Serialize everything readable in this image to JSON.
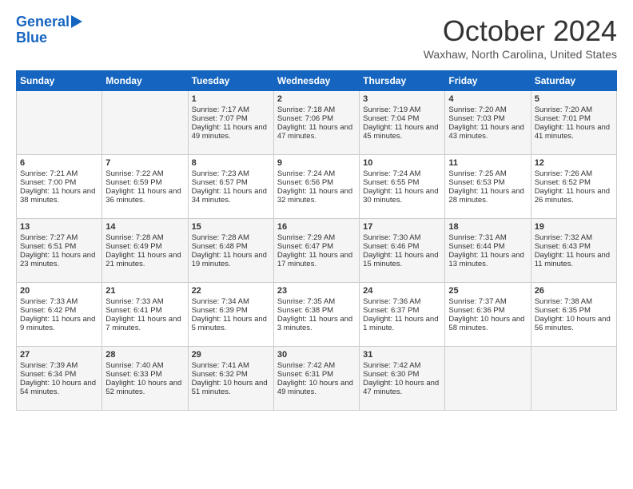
{
  "logo": {
    "line1": "General",
    "line2": "Blue",
    "arrow": true
  },
  "title": "October 2024",
  "location": "Waxhaw, North Carolina, United States",
  "headers": [
    "Sunday",
    "Monday",
    "Tuesday",
    "Wednesday",
    "Thursday",
    "Friday",
    "Saturday"
  ],
  "weeks": [
    [
      {
        "day": "",
        "text": ""
      },
      {
        "day": "",
        "text": ""
      },
      {
        "day": "1",
        "text": "Sunrise: 7:17 AM\nSunset: 7:07 PM\nDaylight: 11 hours and 49 minutes."
      },
      {
        "day": "2",
        "text": "Sunrise: 7:18 AM\nSunset: 7:06 PM\nDaylight: 11 hours and 47 minutes."
      },
      {
        "day": "3",
        "text": "Sunrise: 7:19 AM\nSunset: 7:04 PM\nDaylight: 11 hours and 45 minutes."
      },
      {
        "day": "4",
        "text": "Sunrise: 7:20 AM\nSunset: 7:03 PM\nDaylight: 11 hours and 43 minutes."
      },
      {
        "day": "5",
        "text": "Sunrise: 7:20 AM\nSunset: 7:01 PM\nDaylight: 11 hours and 41 minutes."
      }
    ],
    [
      {
        "day": "6",
        "text": "Sunrise: 7:21 AM\nSunset: 7:00 PM\nDaylight: 11 hours and 38 minutes."
      },
      {
        "day": "7",
        "text": "Sunrise: 7:22 AM\nSunset: 6:59 PM\nDaylight: 11 hours and 36 minutes."
      },
      {
        "day": "8",
        "text": "Sunrise: 7:23 AM\nSunset: 6:57 PM\nDaylight: 11 hours and 34 minutes."
      },
      {
        "day": "9",
        "text": "Sunrise: 7:24 AM\nSunset: 6:56 PM\nDaylight: 11 hours and 32 minutes."
      },
      {
        "day": "10",
        "text": "Sunrise: 7:24 AM\nSunset: 6:55 PM\nDaylight: 11 hours and 30 minutes."
      },
      {
        "day": "11",
        "text": "Sunrise: 7:25 AM\nSunset: 6:53 PM\nDaylight: 11 hours and 28 minutes."
      },
      {
        "day": "12",
        "text": "Sunrise: 7:26 AM\nSunset: 6:52 PM\nDaylight: 11 hours and 26 minutes."
      }
    ],
    [
      {
        "day": "13",
        "text": "Sunrise: 7:27 AM\nSunset: 6:51 PM\nDaylight: 11 hours and 23 minutes."
      },
      {
        "day": "14",
        "text": "Sunrise: 7:28 AM\nSunset: 6:49 PM\nDaylight: 11 hours and 21 minutes."
      },
      {
        "day": "15",
        "text": "Sunrise: 7:28 AM\nSunset: 6:48 PM\nDaylight: 11 hours and 19 minutes."
      },
      {
        "day": "16",
        "text": "Sunrise: 7:29 AM\nSunset: 6:47 PM\nDaylight: 11 hours and 17 minutes."
      },
      {
        "day": "17",
        "text": "Sunrise: 7:30 AM\nSunset: 6:46 PM\nDaylight: 11 hours and 15 minutes."
      },
      {
        "day": "18",
        "text": "Sunrise: 7:31 AM\nSunset: 6:44 PM\nDaylight: 11 hours and 13 minutes."
      },
      {
        "day": "19",
        "text": "Sunrise: 7:32 AM\nSunset: 6:43 PM\nDaylight: 11 hours and 11 minutes."
      }
    ],
    [
      {
        "day": "20",
        "text": "Sunrise: 7:33 AM\nSunset: 6:42 PM\nDaylight: 11 hours and 9 minutes."
      },
      {
        "day": "21",
        "text": "Sunrise: 7:33 AM\nSunset: 6:41 PM\nDaylight: 11 hours and 7 minutes."
      },
      {
        "day": "22",
        "text": "Sunrise: 7:34 AM\nSunset: 6:39 PM\nDaylight: 11 hours and 5 minutes."
      },
      {
        "day": "23",
        "text": "Sunrise: 7:35 AM\nSunset: 6:38 PM\nDaylight: 11 hours and 3 minutes."
      },
      {
        "day": "24",
        "text": "Sunrise: 7:36 AM\nSunset: 6:37 PM\nDaylight: 11 hours and 1 minute."
      },
      {
        "day": "25",
        "text": "Sunrise: 7:37 AM\nSunset: 6:36 PM\nDaylight: 10 hours and 58 minutes."
      },
      {
        "day": "26",
        "text": "Sunrise: 7:38 AM\nSunset: 6:35 PM\nDaylight: 10 hours and 56 minutes."
      }
    ],
    [
      {
        "day": "27",
        "text": "Sunrise: 7:39 AM\nSunset: 6:34 PM\nDaylight: 10 hours and 54 minutes."
      },
      {
        "day": "28",
        "text": "Sunrise: 7:40 AM\nSunset: 6:33 PM\nDaylight: 10 hours and 52 minutes."
      },
      {
        "day": "29",
        "text": "Sunrise: 7:41 AM\nSunset: 6:32 PM\nDaylight: 10 hours and 51 minutes."
      },
      {
        "day": "30",
        "text": "Sunrise: 7:42 AM\nSunset: 6:31 PM\nDaylight: 10 hours and 49 minutes."
      },
      {
        "day": "31",
        "text": "Sunrise: 7:42 AM\nSunset: 6:30 PM\nDaylight: 10 hours and 47 minutes."
      },
      {
        "day": "",
        "text": ""
      },
      {
        "day": "",
        "text": ""
      }
    ]
  ]
}
